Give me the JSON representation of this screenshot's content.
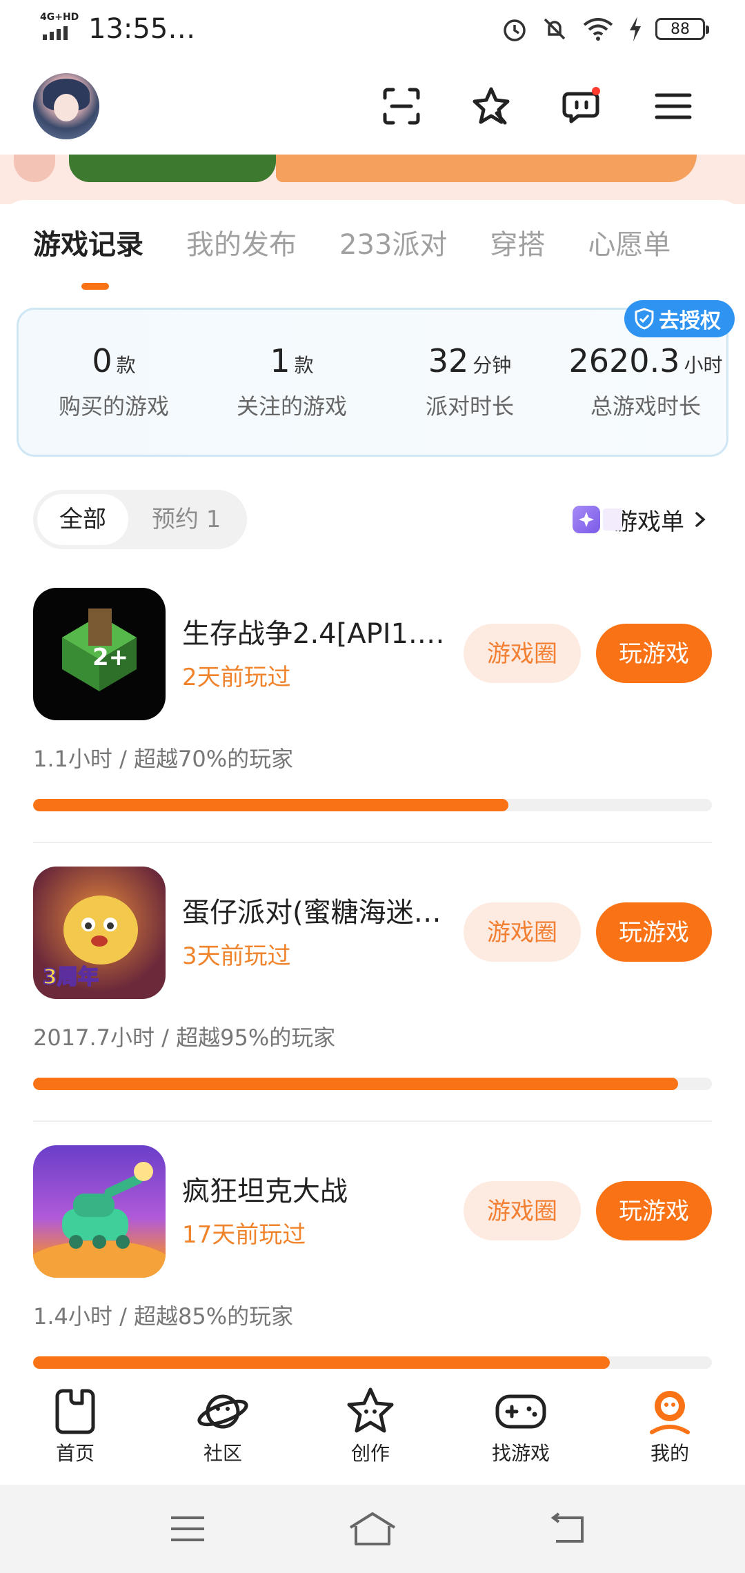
{
  "status": {
    "network": "4G+HD",
    "time": "13:55",
    "more": "…",
    "battery": "88"
  },
  "tabs": [
    "游戏记录",
    "我的发布",
    "233派对",
    "穿搭",
    "心愿单"
  ],
  "auth_badge": "去授权",
  "stats": [
    {
      "value": "0",
      "unit": "款",
      "label": "购买的游戏"
    },
    {
      "value": "1",
      "unit": "款",
      "label": "关注的游戏"
    },
    {
      "value": "32",
      "unit": "分钟",
      "label": "派对时长"
    },
    {
      "value": "2620.3",
      "unit": "小时",
      "label": "总游戏时长"
    }
  ],
  "filter": {
    "all": "全部",
    "reserve": "预约 1"
  },
  "gamelist_link": "游戏单",
  "games": [
    {
      "name": "生存战争2.4[API1.…",
      "played": "2天前玩过",
      "circle_label": "游戏圈",
      "play_label": "玩游戏",
      "stat": "1.1小时 / 超越70%的玩家",
      "progress_pct": 70
    },
    {
      "name": "蛋仔派对(蜜糖海迷…",
      "played": "3天前玩过",
      "circle_label": "游戏圈",
      "play_label": "玩游戏",
      "stat": "2017.7小时 / 超越95%的玩家",
      "progress_pct": 95
    },
    {
      "name": "疯狂坦克大战",
      "played": "17天前玩过",
      "circle_label": "游戏圈",
      "play_label": "玩游戏",
      "stat": "1.4小时 / 超越85%的玩家",
      "progress_pct": 85
    }
  ],
  "nav": [
    "首页",
    "社区",
    "创作",
    "找游戏",
    "我的"
  ],
  "colors": {
    "accent": "#f97316",
    "auth_blue": "#2f93f2"
  }
}
